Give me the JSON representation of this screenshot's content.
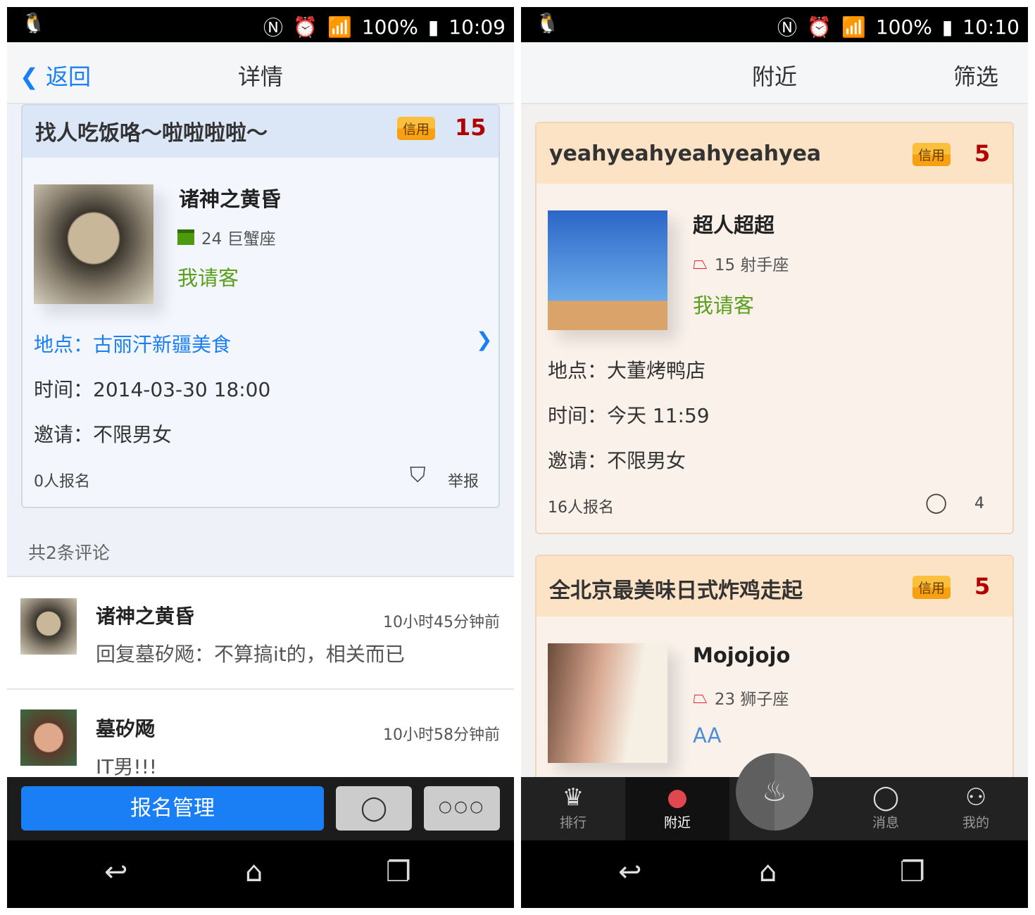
{
  "left": {
    "status": {
      "battery": "100%",
      "time": "10:09"
    },
    "header": {
      "back": "返回",
      "title": "详情"
    },
    "event": {
      "title": "找人吃饭咯～啦啦啦啦～",
      "credit_label": "信用",
      "credit": "15",
      "host_name": "诸神之黄昏",
      "host_age_zodiac": "24 巨蟹座",
      "payment": "我请客",
      "location": "地点：古丽汗新疆美食",
      "time": "时间：2014-03-30 18:00",
      "invite": "邀请：不限男女",
      "signups": "0人报名",
      "report": "举报"
    },
    "comments_count": "共2条评论",
    "comments": [
      {
        "name": "诸神之黄昏",
        "time": "10小时45分钟前",
        "text": "回复墓矽飏：不算搞it的，相关而已"
      },
      {
        "name": "墓矽飏",
        "time": "10小时58分钟前",
        "text": "IT男!!!"
      }
    ],
    "bottom": {
      "manage": "报名管理"
    }
  },
  "right": {
    "status": {
      "battery": "100%",
      "time": "10:10"
    },
    "header": {
      "title": "附近",
      "filter": "筛选"
    },
    "events": [
      {
        "title": "yeahyeahyeahyeahyea",
        "credit_label": "信用",
        "credit": "5",
        "host_name": "超人超超",
        "host_age_zodiac": "15 射手座",
        "payment": "我请客",
        "location": "地点：大董烤鸭店",
        "time": "时间：今天 11:59",
        "invite": "邀请：不限男女",
        "signups": "16人报名",
        "comments": "4"
      },
      {
        "title": "全北京最美味日式炸鸡走起",
        "credit_label": "信用",
        "credit": "5",
        "host_name": "Mojojojo",
        "host_age_zodiac": "23 狮子座",
        "payment": "AA"
      }
    ],
    "tabs": [
      {
        "label": "排行",
        "icon": "crown-icon"
      },
      {
        "label": "附近",
        "icon": "location-pin-icon"
      },
      {
        "label": "",
        "icon": "bowl-icon"
      },
      {
        "label": "消息",
        "icon": "chat-icon"
      },
      {
        "label": "我的",
        "icon": "user-icon"
      }
    ]
  },
  "colors": {
    "accent_blue": "#1a7ef5",
    "credit_red": "#b00000",
    "green": "#5aa01d",
    "pin_red": "#e0474f"
  }
}
